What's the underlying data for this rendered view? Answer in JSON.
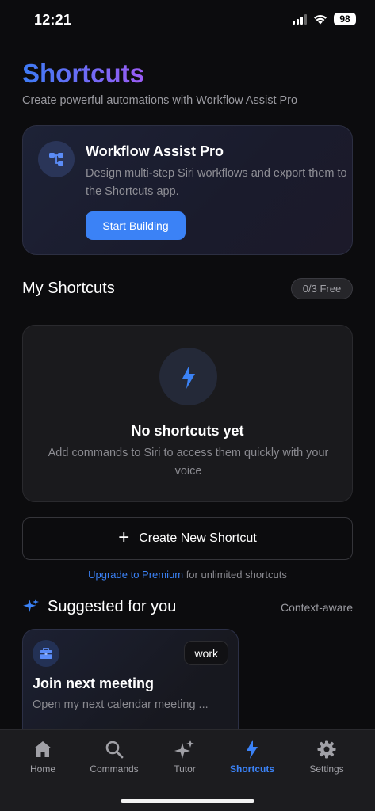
{
  "status_bar": {
    "time": "12:21",
    "battery": "98"
  },
  "header": {
    "title": "Shortcuts",
    "subtitle": "Create powerful automations with Workflow Assist Pro"
  },
  "promo": {
    "title": "Workflow Assist Pro",
    "description": "Design multi-step Siri workflows and export them to the Shortcuts app.",
    "button_label": "Start Building"
  },
  "my_shortcuts": {
    "title": "My Shortcuts",
    "badge": "0/3 Free",
    "empty_title": "No shortcuts yet",
    "empty_description": "Add commands to Siri to access them quickly with your voice",
    "create_label": "Create New Shortcut",
    "upgrade_link": "Upgrade to Premium",
    "upgrade_rest": " for unlimited shortcuts"
  },
  "suggested": {
    "title": "Suggested for you",
    "context": "Context-aware",
    "cards": [
      {
        "tag": "work",
        "name": "Join next meeting",
        "description": "Open my next calendar meeting ...",
        "icon": "briefcase-icon"
      }
    ]
  },
  "tabbar": {
    "items": [
      {
        "label": "Home",
        "icon": "home-icon"
      },
      {
        "label": "Commands",
        "icon": "search-icon"
      },
      {
        "label": "Tutor",
        "icon": "sparkles-icon"
      },
      {
        "label": "Shortcuts",
        "icon": "bolt-icon",
        "active": true
      },
      {
        "label": "Settings",
        "icon": "gear-icon"
      }
    ]
  },
  "colors": {
    "accent": "#3b82f6",
    "title_gradient_start": "#3d7bf6",
    "title_gradient_end": "#9b5cf5"
  }
}
